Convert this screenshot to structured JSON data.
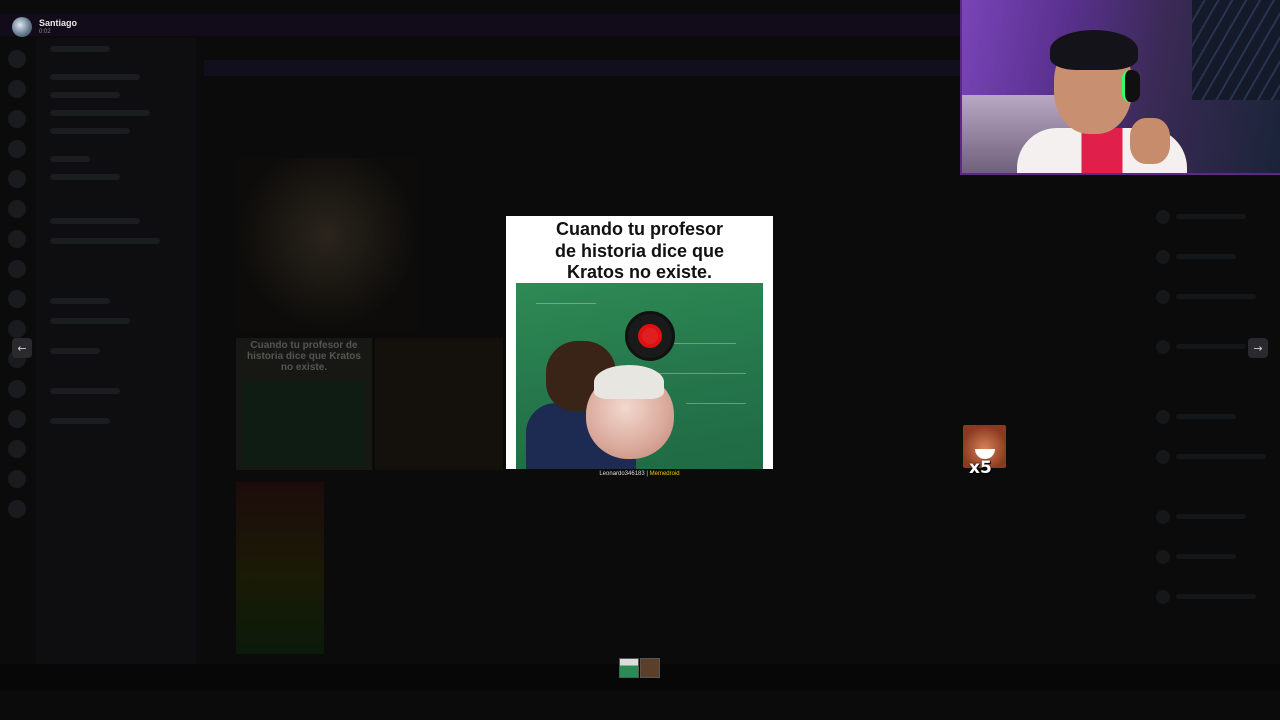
{
  "user": {
    "name": "Santiago",
    "sub": "0:02"
  },
  "viewer": {
    "prev_icon": "arrow-left-icon",
    "next_icon": "arrow-right-icon",
    "prev_glyph": "←",
    "next_glyph": "→"
  },
  "meme": {
    "caption_lines": [
      "Cuando tu profesor",
      "de historia dice que",
      "Kratos no existe."
    ],
    "credit_user": "Leonardo346183 |",
    "credit_site": "Memedroid"
  },
  "background_thumb": {
    "caption": "Cuando tu profesor de historia dice que Kratos no existe."
  },
  "emote_combo": {
    "count": "x5"
  },
  "colors": {
    "accent": "#5c2a86",
    "credit_site": "#f2c200",
    "record_red": "#e02020",
    "headset_green": "#32ff6a"
  }
}
